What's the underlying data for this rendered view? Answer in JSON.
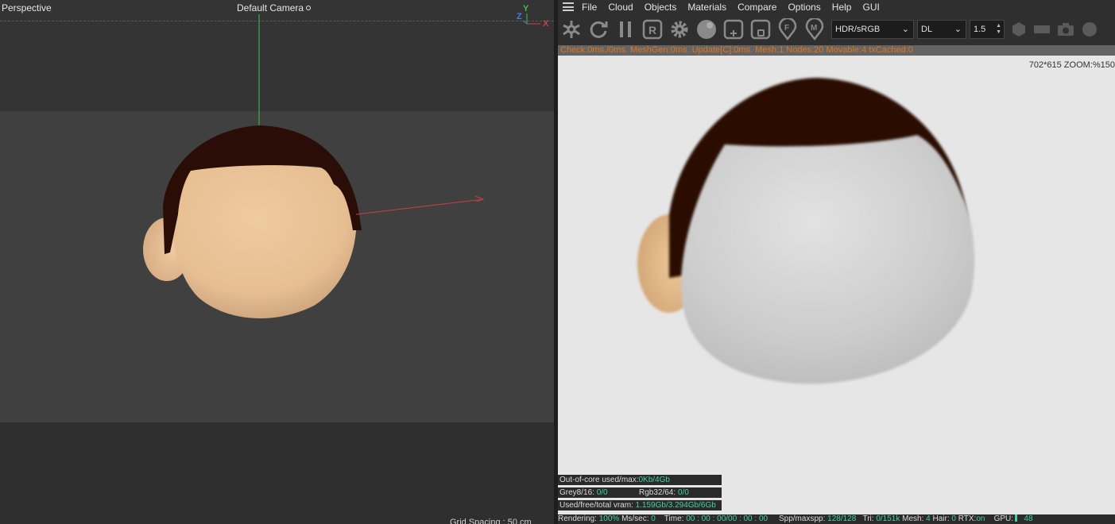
{
  "viewport": {
    "title": "Perspective",
    "camera": "Default Camera",
    "grid_info": "Grid Spacing : 50 cm",
    "axes": {
      "x": "X",
      "y": "Y",
      "z": "Z"
    }
  },
  "menu": {
    "items": [
      "File",
      "Cloud",
      "Objects",
      "Materials",
      "Compare",
      "Options",
      "Help",
      "GUI"
    ]
  },
  "toolbar": {
    "icons": [
      "octane-logo-icon",
      "refresh-icon",
      "pause-icon",
      "region-render-icon",
      "settings-gear-icon",
      "sphere-icon",
      "add-region-icon",
      "film-region-icon",
      "focus-picker-icon",
      "material-picker-icon"
    ],
    "color_space": "HDR/sRGB",
    "kernel": "DL",
    "value": "1.5",
    "right_icons": [
      "cube-icon",
      "rect-icon",
      "camera-icon",
      "circle-icon"
    ]
  },
  "status_top": "Check:0ms./0ms. MeshGen:0ms. Update[C]:0ms. Mesh:1 Nodes:20 Movable:4 txCached:0",
  "render": {
    "resolution": "702*615 ZOOM:%150"
  },
  "info": {
    "ooc_label": "Out-of-core used/max:",
    "ooc_value": "0Kb/4Gb",
    "grey_label": "Grey8/16:",
    "grey_value": "0/0",
    "rgb_label": "Rgb32/64:",
    "rgb_value": "0/0",
    "vram_label": "Used/free/total vram:",
    "vram_value": "1.159Gb/3.294Gb/6Gb"
  },
  "status_bottom": {
    "rendering_label": "Rendering:",
    "rendering_value": "100%",
    "ms_label": "Ms/sec:",
    "ms_value": "0",
    "time_label": "Time:",
    "time_value": "00 : 00 : 00/00 : 00 : 00",
    "spp_label": "Spp/maxspp:",
    "spp_value": "128/128",
    "tri_label": "Tri:",
    "tri_value": "0/151k",
    "mesh_label": "Mesh:",
    "mesh_value": "4",
    "hair_label": "Hair:",
    "hair_value": "0",
    "rtx_label": "RTX:",
    "rtx_value": "on",
    "gpu_label": "GPU:",
    "gpu_value": "48"
  },
  "colors": {
    "hair": "#2a0e06",
    "skin": "#e8c39a",
    "render_bg": "#e6e6e6",
    "status_orange": "#e0761e",
    "value_green": "#43d39a"
  }
}
